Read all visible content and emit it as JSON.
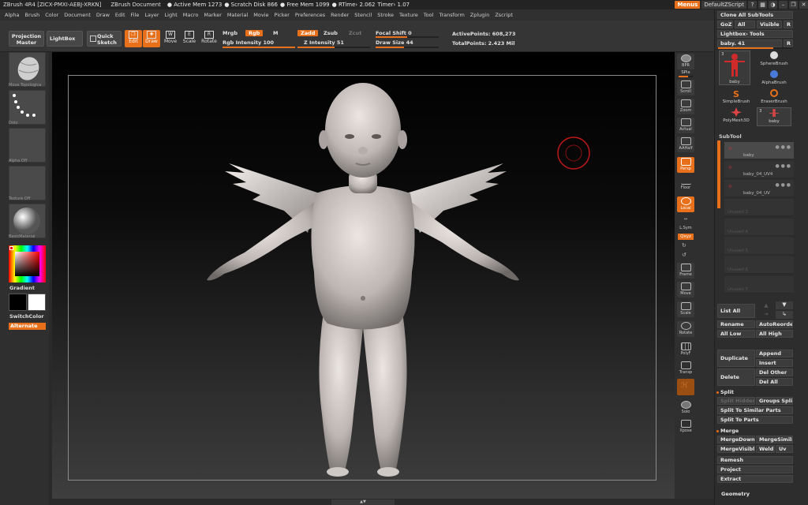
{
  "titlebar": {
    "app": "ZBrush 4R4 [ZICX-PMXI-AEBJ-XRKN]",
    "doc": "ZBrush Document",
    "stats": [
      "● Active Mem 1273",
      "● Scratch Disk 866",
      "● Free Mem 1099",
      "● RTime› 2.062",
      "Timer› 1.07"
    ],
    "menus_btn": "Menus",
    "script_btn": "DefaultZScript"
  },
  "menubar": [
    "Alpha",
    "Brush",
    "Color",
    "Document",
    "Draw",
    "Edit",
    "File",
    "Layer",
    "Light",
    "Macro",
    "Marker",
    "Material",
    "Movie",
    "Picker",
    "Preferences",
    "Render",
    "Stencil",
    "Stroke",
    "Texture",
    "Tool",
    "Transform",
    "Zplugin",
    "Zscript"
  ],
  "topshelf": {
    "projection_master": "Projection Master",
    "lightbox": "LightBox",
    "quick_sketch": "Quick Sketch",
    "edit": "Edit",
    "draw": "Draw",
    "move": "Move",
    "scale": "Scale",
    "rotate": "Rotate",
    "mrgb": "Mrgb",
    "rgb": "Rgb",
    "m": "M",
    "rgb_intensity": "Rgb Intensity 100",
    "zadd": "Zadd",
    "zsub": "Zsub",
    "zcut": "Zcut",
    "z_intensity": "Z Intensity 51",
    "focal_shift": "Focal Shift 0",
    "draw_size": "Draw Size 44",
    "active_points": "ActivePoints: 608,273",
    "total_points": "TotalPoints: 2.423 Mil"
  },
  "leftshelf": {
    "brush_caption": "Move Topologica",
    "stroke_caption": "Dots",
    "alpha_caption": "Alpha Off",
    "texture_caption": "Texture Off",
    "material_caption": "BasicMaterial",
    "gradient": "Gradient",
    "switchcolor": "SwitchColor",
    "alternate": "Alternate"
  },
  "rightshelf": {
    "bpr": "BPR",
    "spix": "SPix",
    "scroll": "Scroll",
    "zoom": "Zoom",
    "actual": "Actual",
    "aahalf": "AAHalf",
    "persp": "Persp",
    "floor": "Floor",
    "local": "Local",
    "lsym": "L.Sym",
    "xyz": "Qxyz",
    "frame": "Frame",
    "move": "Move",
    "scale": "Scale",
    "rotate": "Rotate",
    "polyf": "PolyF",
    "transp": "Transp",
    "ghost": "Ghost",
    "solo": "Solo",
    "xpose": "Xpose"
  },
  "rightpanel": {
    "clone_all": "Clone All SubTools",
    "goz": "GoZ",
    "all": "All",
    "visible": "Visible",
    "r": "R",
    "lightbox_tools": "Lightbox› Tools",
    "tool_name": "baby. 41",
    "tool_r": "R",
    "tools": [
      {
        "name": "baby",
        "count": "3"
      },
      {
        "name": "SphereBrush",
        "count": ""
      },
      {
        "name": "AlphaBrush",
        "count": ""
      },
      {
        "name": "SimpleBrush",
        "count": ""
      },
      {
        "name": "EraserBrush",
        "count": ""
      },
      {
        "name": "PolyMesh3D",
        "count": ""
      },
      {
        "name": "baby",
        "count": "3"
      }
    ],
    "subtool_header": "SubTool",
    "subtools": [
      "baby",
      "baby_04_UV4",
      "baby_04_UV",
      "Unused 3",
      "Unused 4",
      "Unused 5",
      "Unused 6",
      "Unused 7"
    ],
    "list_all": "List All",
    "rename": "Rename",
    "autoreorder": "AutoReorder",
    "all_low": "All Low",
    "all_high": "All High",
    "duplicate": "Duplicate",
    "append": "Append",
    "insert": "Insert",
    "delete": "Delete",
    "del_other": "Del Other",
    "del_all": "Del All",
    "split": "Split",
    "split_hidden": "Split Hidden",
    "groups_split": "Groups Split",
    "split_similar": "Split To Similar Parts",
    "split_parts": "Split To Parts",
    "merge": "Merge",
    "mergedown": "MergeDown",
    "mergesimilar": "MergeSimilar",
    "mergevisible": "MergeVisible",
    "weld": "Weld",
    "uv": "Uv",
    "remesh": "Remesh",
    "project": "Project",
    "extract": "Extract",
    "geometry": "Geometry"
  },
  "colors": {
    "accent": "#e8701a",
    "panel": "#2d2d2d",
    "model": "#d8d2cf"
  }
}
